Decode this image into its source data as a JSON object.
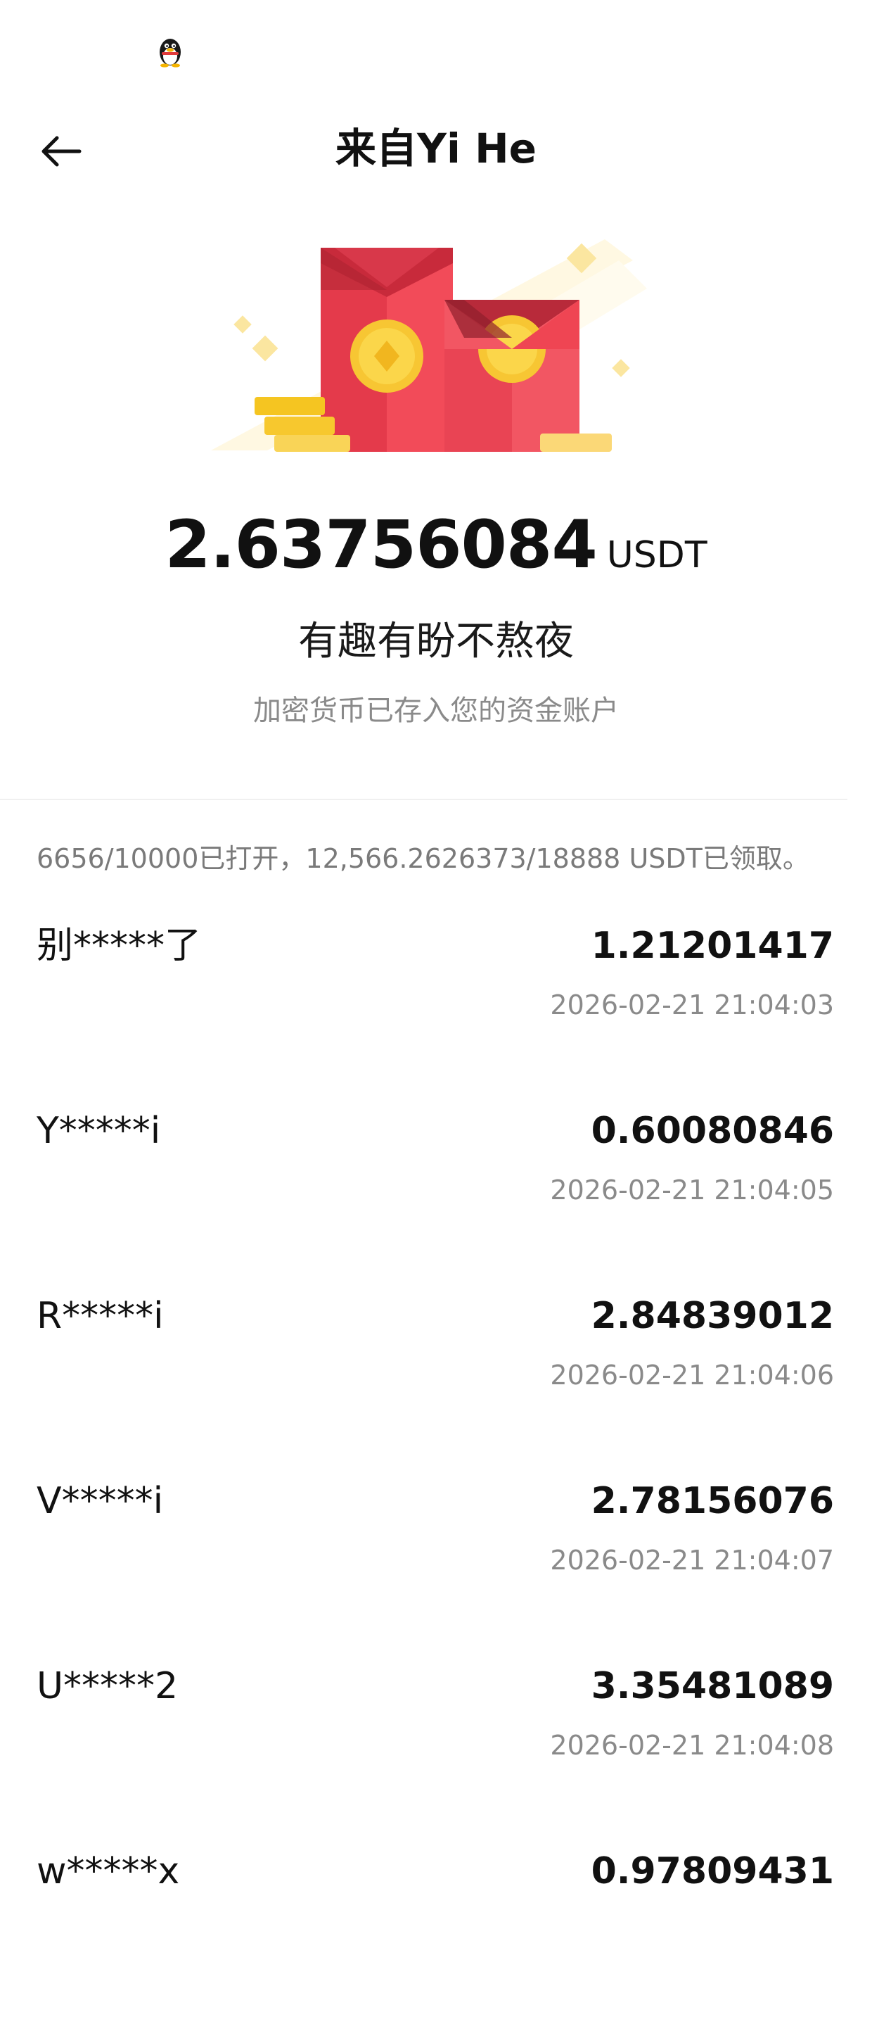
{
  "header": {
    "title": "来自Yi He"
  },
  "red_packet": {
    "amount": "2.63756084",
    "unit": "USDT",
    "blessing": "有趣有盼不熬夜",
    "deposit_note": "加密货币已存入您的资金账户"
  },
  "summary": {
    "text": "6656/10000已打开，12,566.2626373/18888 USDT已领取。"
  },
  "claims": [
    {
      "user": "别*****了",
      "amount": "1.21201417",
      "time": "2026-02-21 21:04:03"
    },
    {
      "user": "Y*****i",
      "amount": "0.60080846",
      "time": "2026-02-21 21:04:05"
    },
    {
      "user": "R*****i",
      "amount": "2.84839012",
      "time": "2026-02-21 21:04:06"
    },
    {
      "user": "V*****i",
      "amount": "2.78156076",
      "time": "2026-02-21 21:04:07"
    },
    {
      "user": "U*****2",
      "amount": "3.35481089",
      "time": "2026-02-21 21:04:08"
    },
    {
      "user": "w*****x",
      "amount": "0.97809431",
      "time": ""
    }
  ],
  "icons": {
    "status": "qq-penguin-icon",
    "back": "arrow-left-icon",
    "illustration": "red-packet-envelopes-icon"
  },
  "colors": {
    "envelope_red": "#ef4553",
    "coin_gold": "#f5c521",
    "text_primary": "#111111",
    "text_secondary": "#8a8a8a"
  }
}
